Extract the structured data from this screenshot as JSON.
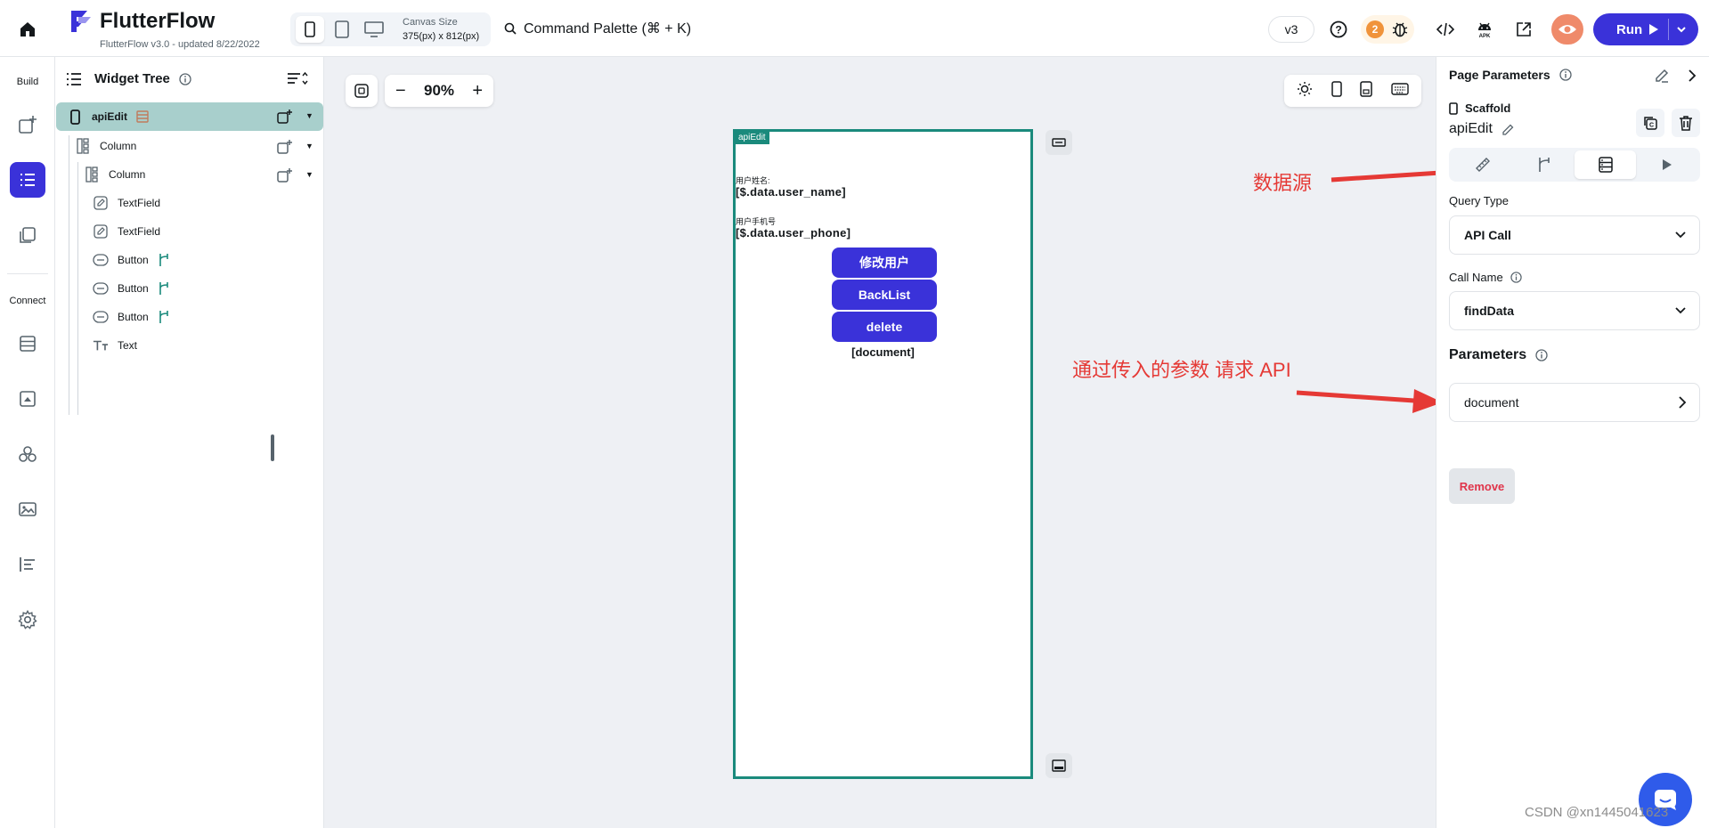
{
  "app": {
    "title": "FlutterFlow",
    "subtitle": "FlutterFlow v3.0 - updated 8/22/2022",
    "accent": "#3a32d9"
  },
  "toolbar": {
    "canvas_size_label": "Canvas Size",
    "canvas_size_value": "375(px) x 812(px)",
    "command_palette": "Command Palette (⌘ + K)",
    "version": "v3",
    "notification_count": "2",
    "run_label": "Run"
  },
  "rail": {
    "build_label": "Build",
    "connect_label": "Connect"
  },
  "widget_tree": {
    "title": "Widget Tree",
    "root": "apiEdit",
    "nodes": [
      {
        "label": "Column"
      },
      {
        "label": "Column"
      },
      {
        "label": "TextField"
      },
      {
        "label": "TextField"
      },
      {
        "label": "Button"
      },
      {
        "label": "Button"
      },
      {
        "label": "Button"
      },
      {
        "label": "Text"
      }
    ]
  },
  "canvas": {
    "zoom": "90%",
    "zoom_minus": "−",
    "zoom_plus": "+",
    "page_tag": "apiEdit",
    "name_label": "用户姓名:",
    "name_value": "[$.data.user_name]",
    "phone_label": "用户手机号",
    "phone_value": "[$.data.user_phone]",
    "buttons": [
      "修改用户",
      "BackList",
      "delete"
    ],
    "document_text": "[document]"
  },
  "annotations": {
    "datasource": "数据源",
    "request_api": "通过传入的参数 请求 API",
    "color": "#e53935"
  },
  "right_panel": {
    "title": "Page Parameters",
    "widget_type": "Scaffold",
    "widget_name": "apiEdit",
    "query_type_label": "Query Type",
    "query_type_value": "API Call",
    "call_name_label": "Call Name",
    "call_name_value": "findData",
    "parameters_label": "Parameters",
    "parameter_item": "document",
    "remove_label": "Remove"
  },
  "watermark": "CSDN @xn1445041623"
}
